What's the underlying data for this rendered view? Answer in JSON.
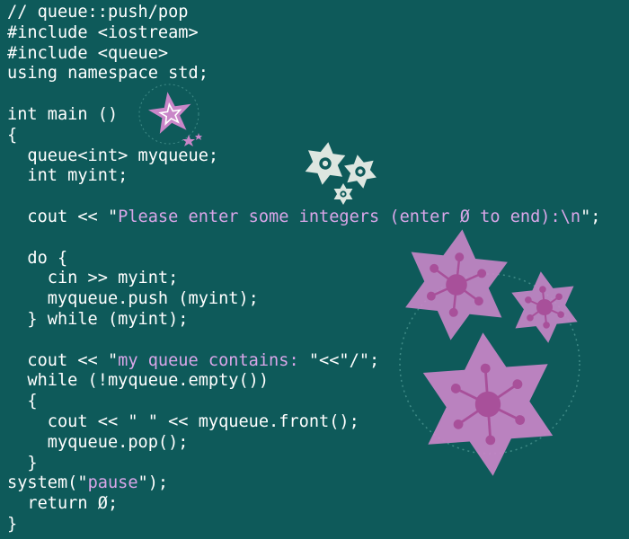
{
  "colors": {
    "background": "#0e5a5a",
    "code_text": "#ffffff",
    "string_literal": "#d9a6e8",
    "star_pink": "#c986c8",
    "star_light": "#dde6e0",
    "star_dark_pink": "#a8509a"
  },
  "decorations": [
    "star-badge-icon",
    "snowflake-star-icon",
    "snowflake-star-icon",
    "snowflake-star-icon",
    "snowflake-star-icon",
    "snowflake-star-icon",
    "snowflake-star-icon"
  ],
  "code": {
    "lines": [
      [
        {
          "t": "// queue::push/pop"
        }
      ],
      [
        {
          "t": "#include <iostream>"
        }
      ],
      [
        {
          "t": "#include <queue>"
        }
      ],
      [
        {
          "t": "using namespace std;"
        }
      ],
      [
        {
          "t": ""
        }
      ],
      [
        {
          "t": "int main ()"
        }
      ],
      [
        {
          "t": "{"
        }
      ],
      [
        {
          "t": "  queue<int> myqueue;"
        }
      ],
      [
        {
          "t": "  int myint;"
        }
      ],
      [
        {
          "t": ""
        }
      ],
      [
        {
          "t": "  cout << \""
        },
        {
          "t": "Please enter some integers (enter Ø to end):\\n",
          "s": 1
        },
        {
          "t": "\";"
        }
      ],
      [
        {
          "t": ""
        }
      ],
      [
        {
          "t": "  do {"
        }
      ],
      [
        {
          "t": "    cin >> myint;"
        }
      ],
      [
        {
          "t": "    myqueue.push (myint);"
        }
      ],
      [
        {
          "t": "  } while (myint);"
        }
      ],
      [
        {
          "t": ""
        }
      ],
      [
        {
          "t": "  cout << \""
        },
        {
          "t": "my queue contains: ",
          "s": 1
        },
        {
          "t": "\"<<\"/\";"
        }
      ],
      [
        {
          "t": "  while (!myqueue.empty())"
        }
      ],
      [
        {
          "t": "  {"
        }
      ],
      [
        {
          "t": "    cout << \" \" << myqueue.front();"
        }
      ],
      [
        {
          "t": "    myqueue.pop();"
        }
      ],
      [
        {
          "t": "  }"
        }
      ],
      [
        {
          "t": "system(\""
        },
        {
          "t": "pause",
          "s": 1
        },
        {
          "t": "\");"
        }
      ],
      [
        {
          "t": "  return Ø;"
        }
      ],
      [
        {
          "t": "}"
        }
      ]
    ]
  }
}
